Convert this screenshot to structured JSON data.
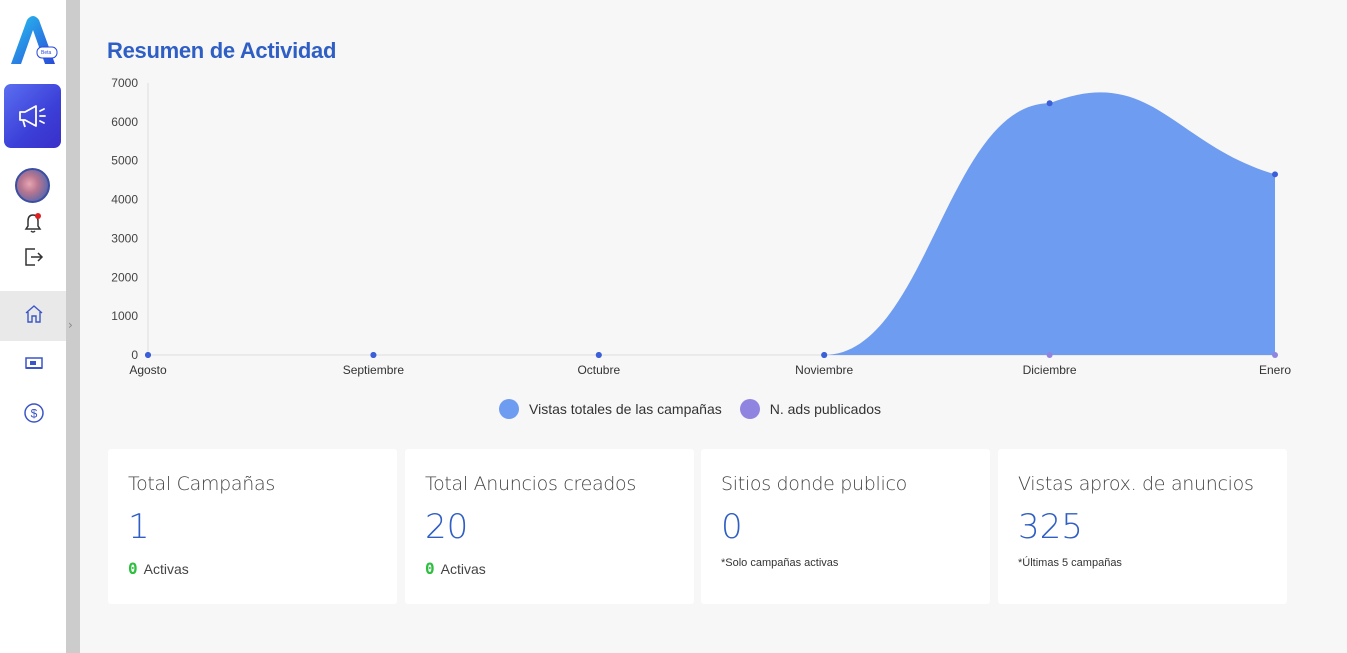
{
  "colors": {
    "accent": "#2f5ec4",
    "area": "#6e9cf0",
    "series2": "#8f85e0",
    "active_green": "#2fbf40"
  },
  "sidebar": {
    "logo_badge": "Beta",
    "icons": [
      "megaphone-icon",
      "avatar",
      "bell-icon",
      "logout-icon",
      "home-icon",
      "ads-icon",
      "dollar-icon"
    ]
  },
  "rail": {
    "chevron": "›"
  },
  "page": {
    "title": "Resumen de Actividad"
  },
  "chart_data": {
    "type": "area",
    "categories": [
      "Agosto",
      "Septiembre",
      "Octubre",
      "Noviembre",
      "Diciembre",
      "Enero"
    ],
    "series": [
      {
        "name": "Vistas totales de las campañas",
        "values": [
          0,
          0,
          0,
          0,
          6480,
          4650
        ],
        "color": "#6e9cf0"
      },
      {
        "name": "N. ads publicados",
        "values": [
          0,
          0,
          0,
          0,
          0,
          0
        ],
        "color": "#8f85e0"
      }
    ],
    "ylim": [
      0,
      7000
    ],
    "yticks": [
      0,
      1000,
      2000,
      3000,
      4000,
      5000,
      6000,
      7000
    ],
    "grid": false,
    "legend": "bottom"
  },
  "cards": [
    {
      "title": "Total Campañas",
      "value": "1",
      "active_count": "0",
      "active_label": "Activas"
    },
    {
      "title": "Total Anuncios creados",
      "value": "20",
      "active_count": "0",
      "active_label": "Activas"
    },
    {
      "title": "Sitios donde publico",
      "value": "0",
      "note": "*Solo campañas activas"
    },
    {
      "title": "Vistas aprox. de anuncios",
      "value": "325",
      "note": "*Últimas 5 campañas"
    }
  ]
}
